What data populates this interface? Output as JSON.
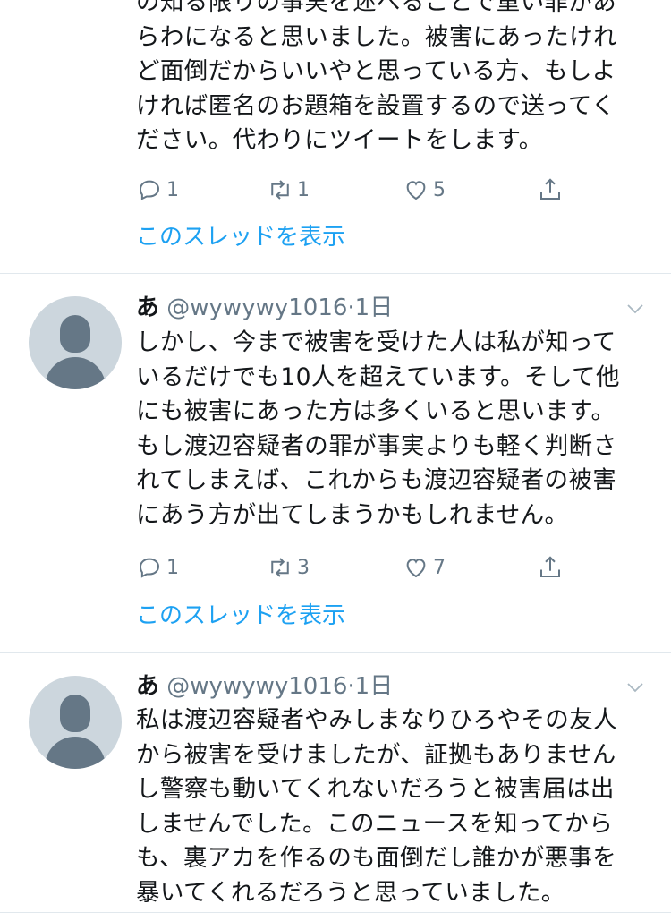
{
  "tweets": [
    {
      "text": "の知る限りの事実を述べることで重い罪があ\nらわになると思いました。被害にあったけれ\nど面倒だからいいやと思っている方、もしよ\nければ匿名のお題箱を設置するので送ってく\nださい。代わりにツイートをします。",
      "reply_count": "1",
      "retweet_count": "1",
      "like_count": "5",
      "show_thread": "このスレッドを表示"
    },
    {
      "name": "あ",
      "handle": "@wywywy1016",
      "dot": "·",
      "time": "1日",
      "text": "しかし、今まで被害を受けた人は私が知って\nいるだけでも10人を超えています。そして他\nにも被害にあった方は多くいると思います。\nもし渡辺容疑者の罪が事実よりも軽く判断さ\nれてしまえば、これからも渡辺容疑者の被害\nにあう方が出てしまうかもしれません。",
      "reply_count": "1",
      "retweet_count": "3",
      "like_count": "7",
      "show_thread": "このスレッドを表示"
    },
    {
      "name": "あ",
      "handle": "@wywywy1016",
      "dot": "·",
      "time": "1日",
      "text": "私は渡辺容疑者やみしまなりひろやその友人\nから被害を受けましたが、証拠もありません\nし警察も動いてくれないだろうと被害届は出\nしませんでした。このニュースを知ってから\nも、裏アカを作るのも面倒だし誰かが悪事を\n暴いてくれるだろうと思っていました。"
    }
  ],
  "colors": {
    "text": "#14171a",
    "muted": "#657786",
    "link": "#1da1f2",
    "divider": "#e1e8ed",
    "avatar_bg": "#ccd6dd"
  },
  "icons": [
    "reply-icon",
    "retweet-icon",
    "like-icon",
    "share-icon",
    "chevron-down-icon",
    "default-avatar-icon"
  ]
}
